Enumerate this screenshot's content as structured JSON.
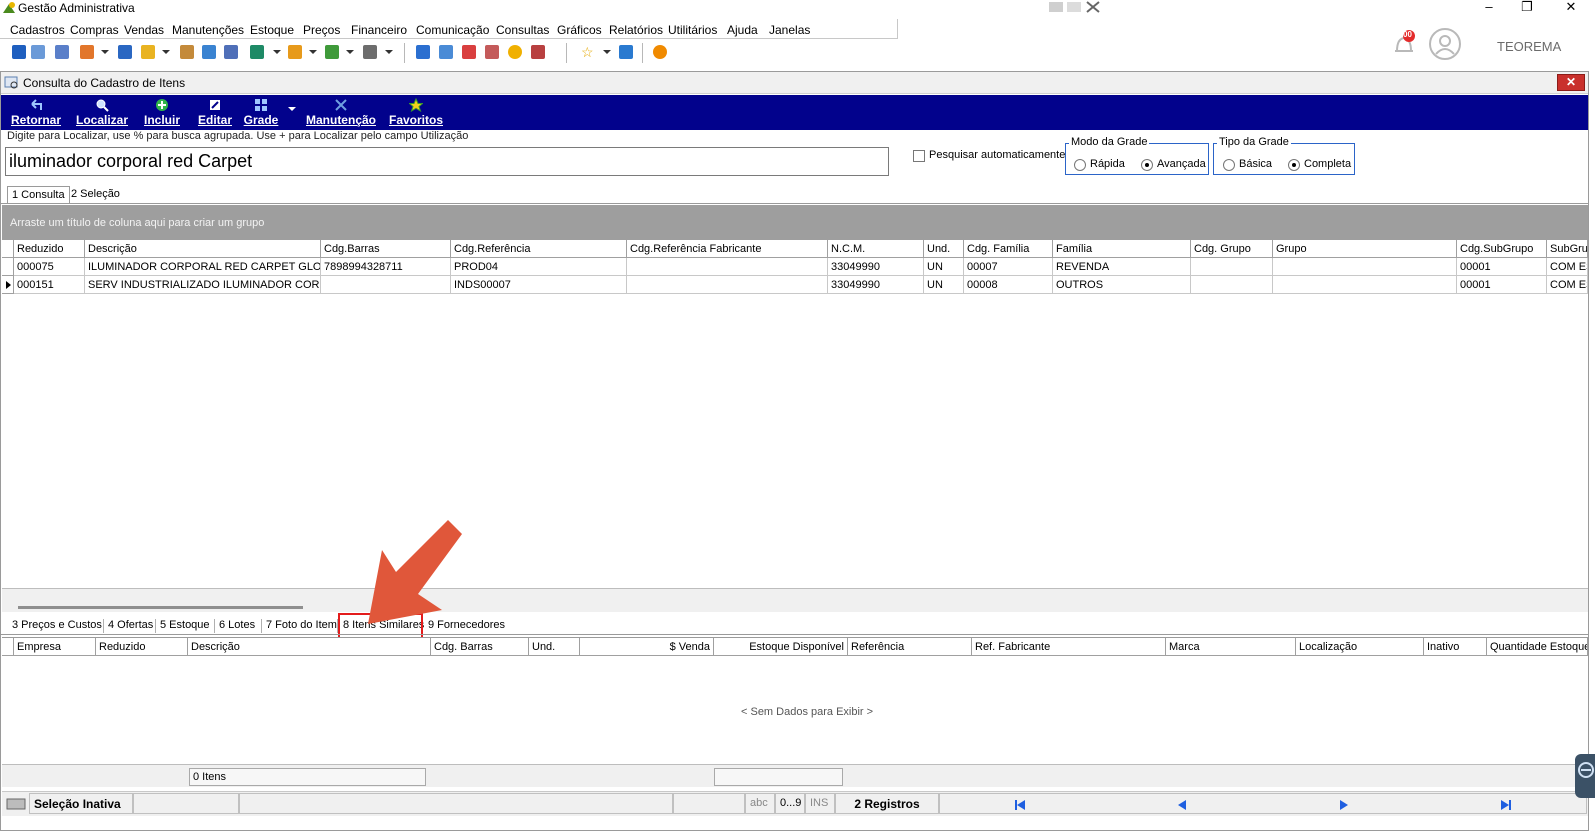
{
  "app": {
    "title": "Gestão Administrativa",
    "user": "TEOREMA",
    "notifications": "00"
  },
  "menu": [
    "Cadastros",
    "Compras",
    "Vendas",
    "Manutenções",
    "Estoque",
    "Preços",
    "Financeiro",
    "Comunicação",
    "Consultas",
    "Gráficos",
    "Relatórios",
    "Utilitários",
    "Ajuda",
    "Janelas"
  ],
  "window": {
    "title": "Consulta do Cadastro de Itens"
  },
  "actions": [
    "Retornar",
    "Localizar",
    "Incluir",
    "Editar",
    "Grade",
    "Manutenção",
    "Favoritos"
  ],
  "search": {
    "label": "Digite para Localizar, use % para busca agrupada. Use + para Localizar pelo campo Utilização",
    "value": "iluminador corporal red Carpet",
    "auto_label": "Pesquisar automaticamente"
  },
  "modo_grade": {
    "legend": "Modo da Grade",
    "options": [
      "Rápida",
      "Avançada"
    ],
    "selected": "Avançada"
  },
  "tipo_grade": {
    "legend": "Tipo da Grade",
    "options": [
      "Básica",
      "Completa"
    ],
    "selected": "Completa"
  },
  "top_tabs": [
    "1 Consulta",
    "2 Seleção"
  ],
  "group_hint": "Arraste um título de coluna aqui para criar um grupo",
  "grid1": {
    "columns": [
      "Reduzido",
      "Descrição",
      "Cdg.Barras",
      "Cdg.Referência",
      "Cdg.Referência Fabricante",
      "N.C.M.",
      "Und.",
      "Cdg. Família",
      "Família",
      "Cdg. Grupo",
      "Grupo",
      "Cdg.SubGrupo",
      "SubGrupo"
    ],
    "rows": [
      [
        "000075",
        "ILUMINADOR CORPORAL RED CARPET GLOW",
        "7898994328711",
        "PROD04",
        "",
        "33049990",
        "UN",
        "00007",
        "REVENDA",
        "",
        "",
        "00001",
        "COM EST"
      ],
      [
        "000151",
        "SERV INDUSTRIALIZADO ILUMINADOR CORPO",
        "",
        "INDS00007",
        "",
        "33049990",
        "UN",
        "00008",
        "OUTROS",
        "",
        "",
        "00001",
        "COM EST"
      ]
    ]
  },
  "bottom_tabs": [
    "3 Preços e Custos",
    "4 Ofertas",
    "5 Estoque",
    "6 Lotes",
    "7 Foto do Item",
    "8 Itens Similares",
    "9 Fornecedores"
  ],
  "grid2": {
    "columns": [
      "Empresa",
      "Reduzido",
      "Descrição",
      "Cdg. Barras",
      "Und.",
      "$ Venda",
      "Estoque Disponível",
      "Referência",
      "Ref. Fabricante",
      "Marca",
      "Localização",
      "Inativo",
      "Quantidade Estoque"
    ],
    "empty": "< Sem Dados para Exibir >",
    "count": "0 Itens"
  },
  "status": {
    "selection": "Seleção Inativa",
    "abc": "abc",
    "num": "0...9",
    "ins": "INS",
    "records": "2 Registros"
  },
  "colors": {
    "action_bar": "#02028c",
    "highlight": "#e31b1b",
    "arrow": "#e0573a"
  }
}
